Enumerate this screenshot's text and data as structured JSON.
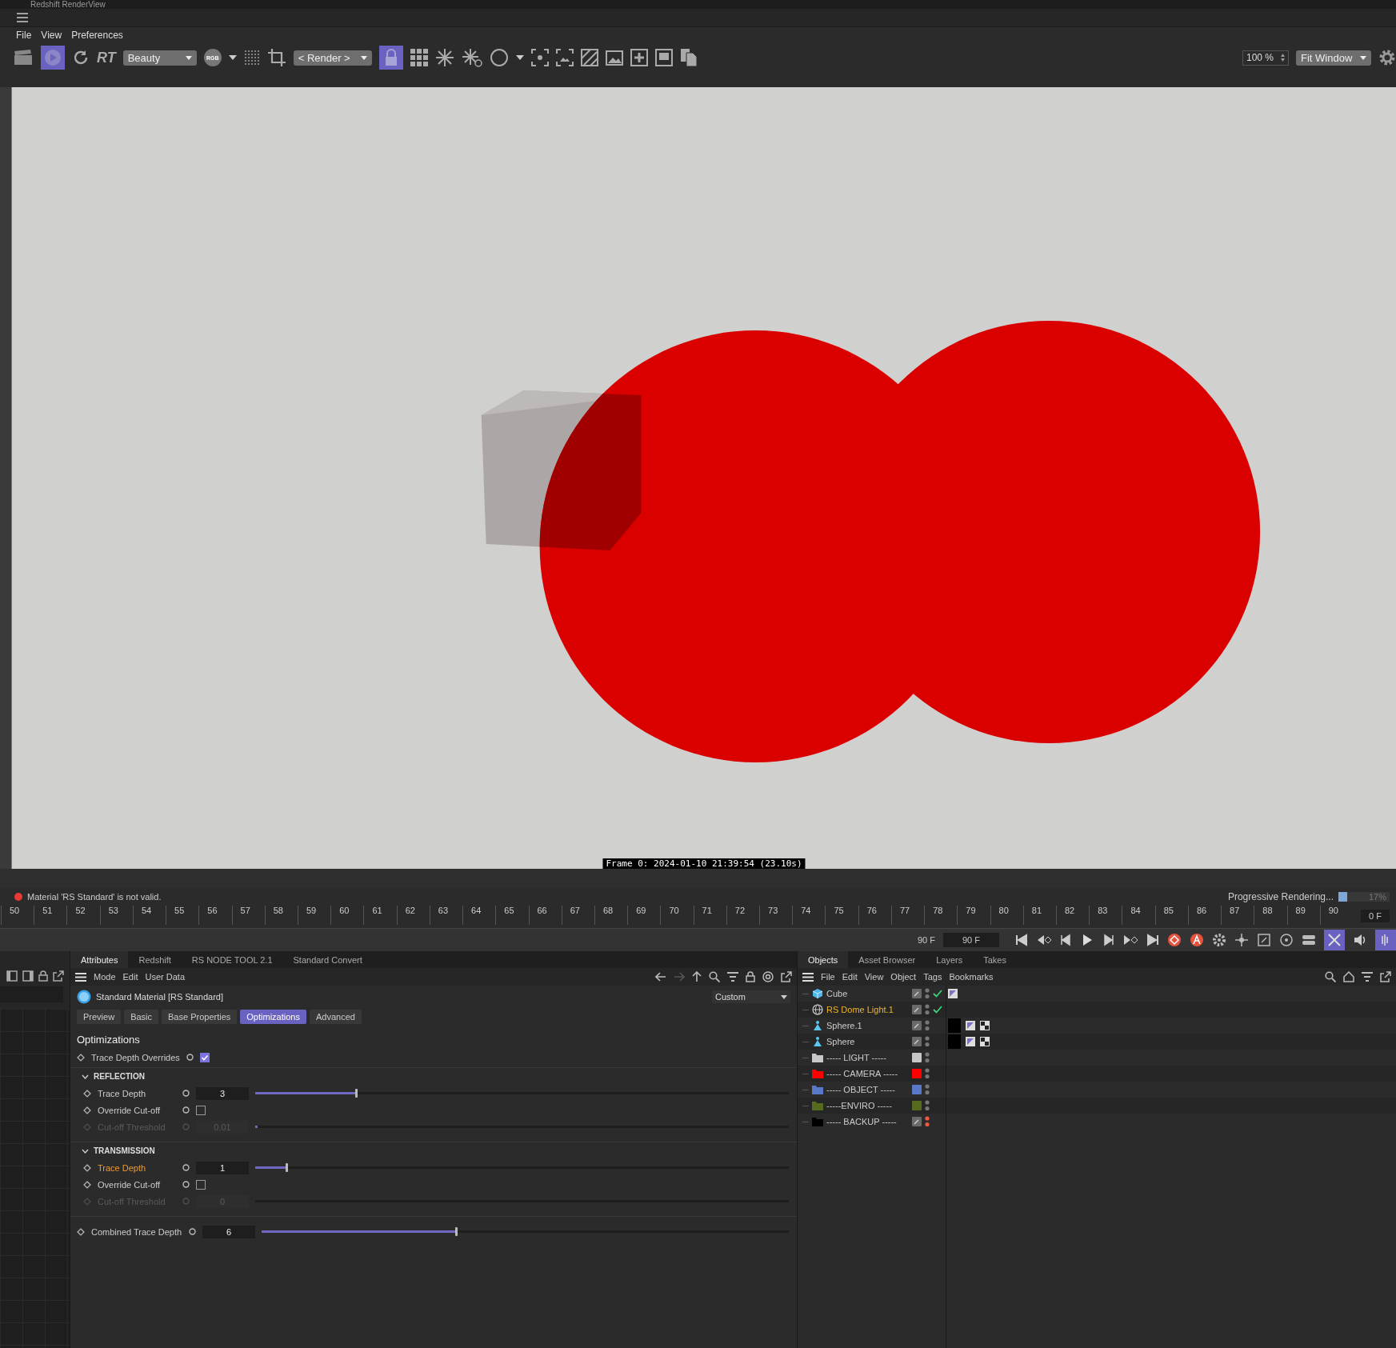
{
  "window": {
    "title": "Redshift RenderView"
  },
  "menu": [
    "File",
    "View",
    "Preferences"
  ],
  "toolbar": {
    "render_active": true,
    "rt_label": "RT",
    "aov": "Beauty",
    "rgb": "RGB",
    "camera": "< Render >",
    "lock_on": true,
    "zoom": "100 %",
    "fit": "Fit Window"
  },
  "render": {
    "frame_info": "Frame 0: 2024-01-10 21:39:54 (23.10s)"
  },
  "status": {
    "message": "Material 'RS Standard' is not valid.",
    "progress_label": "Progressive Rendering...",
    "level": 0.17,
    "percent": "17%"
  },
  "timeline": {
    "ticks": [
      "50",
      "51",
      "52",
      "53",
      "54",
      "55",
      "56",
      "57",
      "58",
      "59",
      "60",
      "61",
      "62",
      "63",
      "64",
      "65",
      "66",
      "67",
      "68",
      "69",
      "70",
      "71",
      "72",
      "73",
      "74",
      "75",
      "76",
      "77",
      "78",
      "79",
      "80",
      "81",
      "82",
      "83",
      "84",
      "85",
      "86",
      "87",
      "88",
      "89",
      "90"
    ],
    "current_frame": "0 F",
    "end_label": "90 F",
    "end_field": "90 F"
  },
  "attributes": {
    "tabs": [
      {
        "label": "Attributes",
        "selected": true
      },
      {
        "label": "Redshift",
        "selected": false
      },
      {
        "label": "RS NODE TOOL 2.1",
        "selected": false
      },
      {
        "label": "Standard Convert",
        "selected": false
      }
    ],
    "menu": [
      "Mode",
      "Edit",
      "User Data"
    ],
    "material": "Standard Material [RS Standard]",
    "preset": "Custom",
    "subtabs": [
      {
        "label": "Preview",
        "selected": false
      },
      {
        "label": "Basic",
        "selected": false
      },
      {
        "label": "Base Properties",
        "selected": false
      },
      {
        "label": "Optimizations",
        "selected": true
      },
      {
        "label": "Advanced",
        "selected": false
      }
    ],
    "section": "Optimizations",
    "overrides": {
      "label": "Trace Depth Overrides",
      "checked": true
    },
    "groups": [
      {
        "title": "REFLECTION",
        "expanded": true,
        "rows": [
          {
            "kind": "slider",
            "label": "Trace Depth",
            "value": "3",
            "level": 0.19,
            "disabled": false,
            "modified": false
          },
          {
            "kind": "checkbox",
            "label": "Override Cut-off",
            "checked": false
          },
          {
            "kind": "slider",
            "label": "Cut-off Threshold",
            "value": "0.01",
            "level": 0.005,
            "disabled": true,
            "modified": false
          }
        ]
      },
      {
        "title": "TRANSMISSION",
        "expanded": true,
        "rows": [
          {
            "kind": "slider",
            "label": "Trace Depth",
            "value": "1",
            "level": 0.06,
            "disabled": false,
            "modified": true
          },
          {
            "kind": "checkbox",
            "label": "Override Cut-off",
            "checked": false
          },
          {
            "kind": "slider",
            "label": "Cut-off Threshold",
            "value": "0",
            "disabled": true,
            "modified": false
          }
        ]
      }
    ],
    "combined": {
      "label": "Combined Trace Depth",
      "value": "6",
      "level": 0.37
    }
  },
  "objects": {
    "tabs": [
      {
        "label": "Objects",
        "selected": true
      },
      {
        "label": "Asset Browser",
        "selected": false
      },
      {
        "label": "Layers",
        "selected": false
      },
      {
        "label": "Takes",
        "selected": false
      }
    ],
    "menu": [
      "File",
      "Edit",
      "View",
      "Object",
      "Tags",
      "Bookmarks"
    ],
    "items": [
      {
        "kind": "cube",
        "name": "Cube",
        "selected": false,
        "enabled": true,
        "tags": [
          {
            "kind": "phong"
          }
        ]
      },
      {
        "kind": "light",
        "name": "RS Dome Light.1",
        "selected": true,
        "enabled": true
      },
      {
        "kind": "sphere",
        "name": "Sphere.1",
        "selected": false,
        "enabled": false,
        "tags": [
          {
            "kind": "material"
          },
          {
            "kind": "phong"
          },
          {
            "kind": "checker"
          }
        ]
      },
      {
        "kind": "sphere",
        "name": "Sphere",
        "selected": false,
        "enabled": false,
        "tags": [
          {
            "kind": "material"
          },
          {
            "kind": "phong"
          },
          {
            "kind": "checker"
          }
        ]
      },
      {
        "kind": "folder",
        "name": "----- LIGHT -----",
        "selected": false,
        "color": "#c8c8c8"
      },
      {
        "kind": "folder",
        "name": "----- CAMERA -----",
        "selected": false,
        "color": "#ff0000"
      },
      {
        "kind": "folder",
        "name": "----- OBJECT -----",
        "selected": false,
        "color": "#5a78c8"
      },
      {
        "kind": "folder",
        "name": "-----ENVIRO -----",
        "selected": false,
        "color": "#566b1e"
      },
      {
        "kind": "folder",
        "name": "----- BACKUP -----",
        "selected": false,
        "color": "#000000",
        "dots_red": true
      }
    ]
  }
}
